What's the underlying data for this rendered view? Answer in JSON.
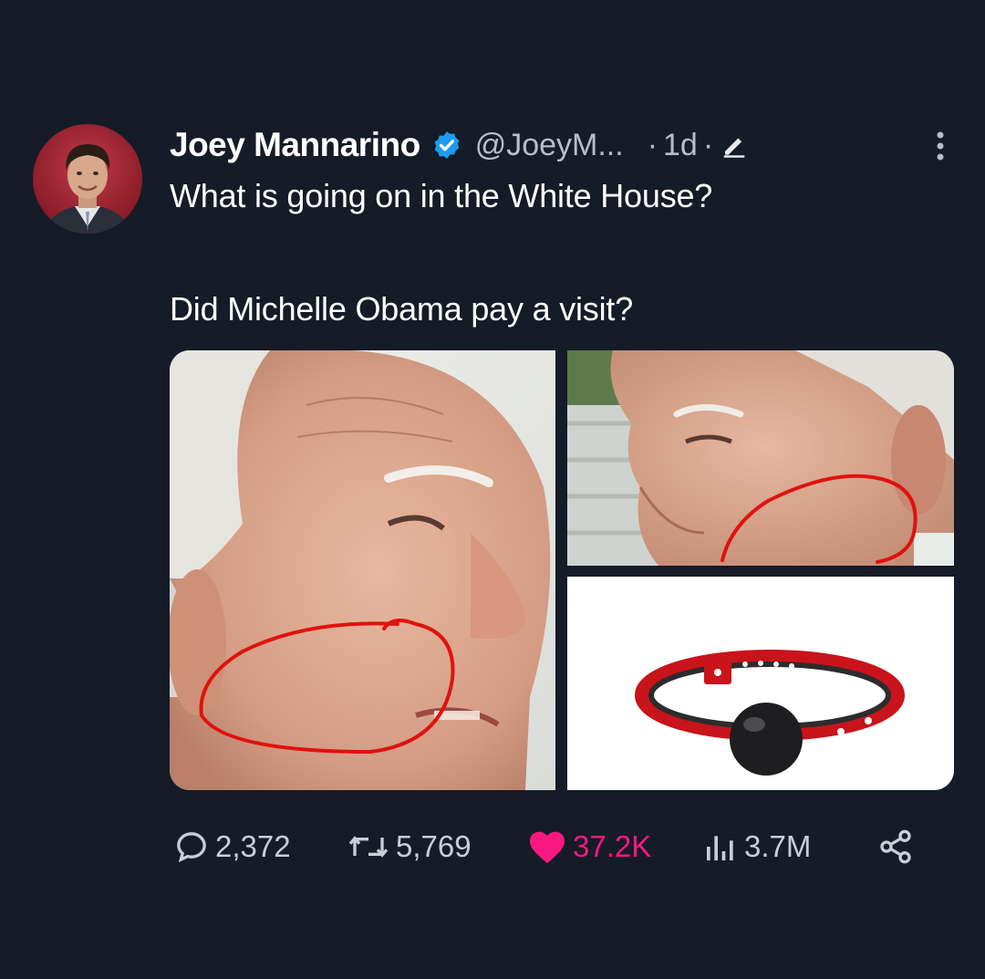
{
  "tweet": {
    "author_name": "Joey Mannarino",
    "handle": "@JoeyM...",
    "separator": "·",
    "time_ago": "1d",
    "separator2": "·",
    "line1": "What is going on in the White House?",
    "line2": "Did Michelle Obama pay a visit?",
    "icons": {
      "verified": "verified-badge-icon",
      "edit": "edited-pencil-icon",
      "more": "more-options-icon"
    }
  },
  "metrics": {
    "replies": "2,372",
    "retweets": "5,769",
    "likes": "37.2K",
    "views": "3.7M"
  },
  "colors": {
    "background": "#151b27",
    "verified": "#1d9bf0",
    "like": "#f91880",
    "secondary_text": "#b8bec6"
  }
}
